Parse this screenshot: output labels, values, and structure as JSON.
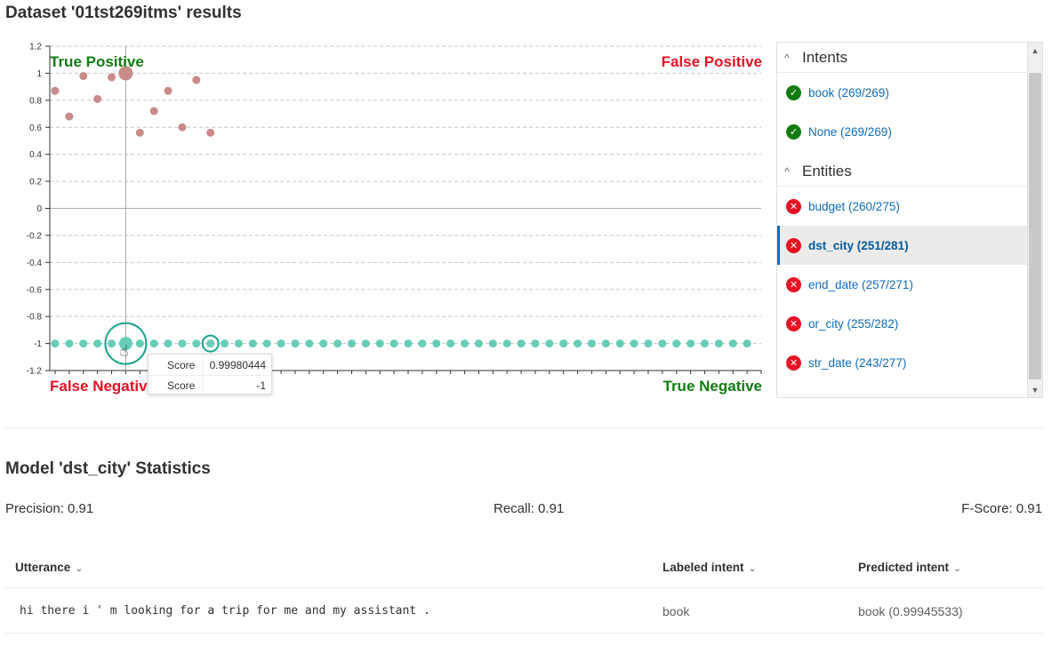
{
  "page": {
    "title": "Dataset '01tst269itms' results"
  },
  "chart_data": {
    "type": "scatter",
    "ylim": [
      -1.2,
      1.2
    ],
    "yticks": [
      "1.2",
      "1",
      "0.8",
      "0.6",
      "0.4",
      "0.2",
      "0",
      "-0.2",
      "-0.4",
      "-0.6",
      "-0.8",
      "-1",
      "-1.2"
    ],
    "grid": true,
    "quadrants": {
      "top_left": "True Positive",
      "top_right": "False Positive",
      "bottom_left": "False Negative",
      "bottom_right": "True Negative"
    },
    "colors": {
      "positive_points": "#c98a8a",
      "negative_points": "#66cdb8",
      "tp": "#107c10",
      "fp": "#e81123"
    },
    "series": [
      {
        "values": [
          0.87,
          0.68,
          0.98,
          0.81,
          0.97,
          1.0,
          0.56,
          0.72,
          0.87,
          0.6,
          0.95,
          0.56
        ]
      },
      {
        "count": 50,
        "value": -1
      }
    ],
    "highlighted_index": 5
  },
  "tooltip": {
    "rows": [
      {
        "label": "Score",
        "value": "0.99980444"
      },
      {
        "label": "Score",
        "value": "-1"
      }
    ]
  },
  "panel": {
    "intents_title": "Intents",
    "intents": [
      {
        "label": "book (269/269)",
        "status": "ok"
      },
      {
        "label": "None (269/269)",
        "status": "ok"
      }
    ],
    "entities_title": "Entities",
    "entities": [
      {
        "label": "budget (260/275)",
        "status": "err"
      },
      {
        "label": "dst_city (251/281)",
        "status": "err",
        "selected": true
      },
      {
        "label": "end_date (257/271)",
        "status": "err"
      },
      {
        "label": "or_city (255/282)",
        "status": "err"
      },
      {
        "label": "str_date (243/277)",
        "status": "err"
      }
    ]
  },
  "model": {
    "title": "Model 'dst_city' Statistics",
    "precision": "Precision: 0.91",
    "recall": "Recall: 0.91",
    "fscore": "F-Score: 0.91"
  },
  "table": {
    "headers": {
      "utterance": "Utterance",
      "labeled": "Labeled intent",
      "predicted": "Predicted intent"
    },
    "rows": [
      {
        "utterance": "hi there i ' m looking for a trip for me and my assistant .",
        "labeled": "book",
        "predicted": "book (0.99945533)"
      }
    ]
  }
}
